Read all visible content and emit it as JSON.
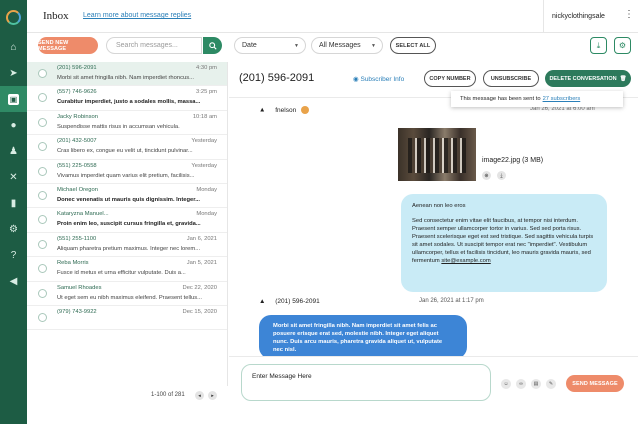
{
  "app": {
    "title": "Inbox",
    "learn_link": "Learn more about message replies",
    "account": "nickyclothingsale",
    "menu_glyph": "⋮"
  },
  "colors": {
    "sidebar": "#1d5c44",
    "accent": "#2d8a64",
    "orange": "#ee8b6a",
    "bubble_in": "#c9ebf6",
    "bubble_out": "#3d85d6",
    "link": "#2a7fb8"
  },
  "sidebar": {
    "items": [
      {
        "icon": "home-icon",
        "glyph": "⌂"
      },
      {
        "icon": "send-icon",
        "glyph": "➤"
      },
      {
        "icon": "inbox-icon",
        "glyph": "▣"
      },
      {
        "icon": "chat-icon",
        "glyph": "●"
      },
      {
        "icon": "contacts-icon",
        "glyph": "♟"
      },
      {
        "icon": "shuffle-icon",
        "glyph": "✕"
      },
      {
        "icon": "analytics-icon",
        "glyph": "▮"
      },
      {
        "icon": "settings-icon",
        "glyph": "⚙"
      },
      {
        "icon": "help-icon",
        "glyph": "?"
      },
      {
        "icon": "megaphone-icon",
        "glyph": "◀"
      }
    ]
  },
  "toolbar": {
    "send_new": "SEND NEW MESSAGE",
    "search_placeholder": "Search messages...",
    "date_select": "Date",
    "messages_select": "All Messages",
    "select_all": "SELECT ALL",
    "caret": "▼",
    "download_glyph": "⤓",
    "settings_glyph": "⚙"
  },
  "conversations": [
    {
      "name": "(201) 596-2091",
      "time": "4:30 pm",
      "preview": "Morbi sit amet fringilla nibh. Nam imperdiet  rhoncus...",
      "selected": true,
      "unread": false
    },
    {
      "name": "(557) 746-9626",
      "time": "3:25 pm",
      "preview": "Curabitur imperdiet, justo a sodales mollis, massa...",
      "selected": false,
      "unread": true
    },
    {
      "name": "Jacky Robinson",
      "time": "10:18 am",
      "preview": "Suspendisse mattis risus in accumsan vehicula.",
      "selected": false,
      "unread": false
    },
    {
      "name": "(201) 432-5007",
      "time": "Yesterday",
      "preview": "Cras libero ex, congue eu velit ut, tincidunt pulvinar...",
      "selected": false,
      "unread": false
    },
    {
      "name": "(551) 225-0558",
      "time": "Yesterday",
      "preview": "Vivamus imperdiet quam varius elit pretium, facilisis...",
      "selected": false,
      "unread": false
    },
    {
      "name": "Michael Oregon",
      "time": "Monday",
      "preview": "Donec venenatis ut mauris quis dignissim. Integer...",
      "selected": false,
      "unread": true
    },
    {
      "name": "Kataryzna Manuel...",
      "time": "Monday",
      "preview": "Proin enim leo, suscipit cursus fringilla et, gravida...",
      "selected": false,
      "unread": true
    },
    {
      "name": "(551) 255-1100",
      "time": "Jan 6, 2021",
      "preview": "Aliquam pharetra pretium maximus. Integer nec lorem...",
      "selected": false,
      "unread": false
    },
    {
      "name": "Reba Morris",
      "time": "Jan 5, 2021",
      "preview": "Fusce id metus et urna efficitur vulputate. Duis a...",
      "selected": false,
      "unread": false
    },
    {
      "name": "Samuel Rhoades",
      "time": "Dec 22, 2020",
      "preview": "Ut eget sem eu nibh maximus eleifend. Praesent tellus...",
      "selected": false,
      "unread": false
    },
    {
      "name": "(979) 743-9922",
      "time": "Dec 15, 2020",
      "preview": "",
      "selected": false,
      "unread": false
    }
  ],
  "pagination": {
    "label": "1-100 of 281",
    "prev": "◂",
    "next": "▸"
  },
  "conversation": {
    "phone": "(201) 596-2091",
    "subscriber_info": "Subscriber Info",
    "copy_number": "COPY NUMBER",
    "unsubscribe": "UNSUBSCRIBE",
    "delete": "DELETE CONVERSATION",
    "tooltip_text": "This message has been sent to",
    "tooltip_link": "27 subscribers",
    "sender_name": "fnelson",
    "sender_date": "Jan 26, 2021 at 6:00 am",
    "attachment_name": "image22.jpg (3 MB)",
    "incoming_subject": "Aenean non leo eros",
    "incoming_body": "Sed consectetur enim vitae elit faucibus, at tempor nisi interdum. Praesent semper ullamcorper tortor in varius. Sed sed porta risus. Praesent scelerisque eget est sed tristique. Sed sagittis vehicula turpis sit amet sodales. Ut suscipit tempor erat nec \"imperdiet\". Vestibulum ullamcorper, tellus et facilisis tincidunt, leo mauris gravida mauris, sed fermentum",
    "incoming_email": "site@example.com",
    "reply_sender": "(201) 596-2091",
    "reply_date": "Jan 26, 2021 at 1:17 pm",
    "outgoing_body": "Morbi sit amet fringilla nibh. Nam imperdiet sit amet felis ac posuere erisque erat sed, molestie nibh. Integer eget aliquet nunc. Duis arcu mauris, pharetra gravida aliquet ut, vulputate nec nisl."
  },
  "composer": {
    "placeholder": "Enter Message Here",
    "send": "SEND MESSAGE"
  }
}
